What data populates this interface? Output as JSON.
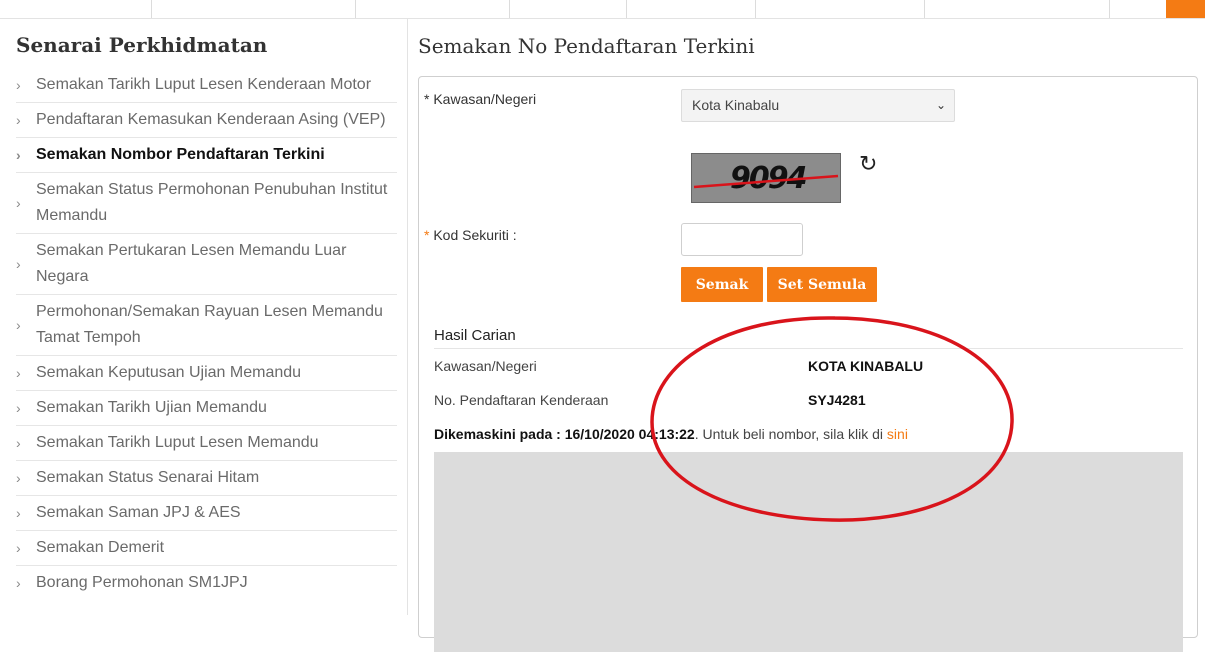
{
  "sidebar": {
    "title": "Senarai Perkhidmatan",
    "items": [
      {
        "label": "Semakan Tarikh Luput Lesen Kenderaan Motor"
      },
      {
        "label": "Pendaftaran Kemasukan Kenderaan Asing (VEP)"
      },
      {
        "label": "Semakan Nombor Pendaftaran Terkini"
      },
      {
        "label": "Semakan Status Permohonan Penubuhan Institut Memandu"
      },
      {
        "label": "Semakan Pertukaran Lesen Memandu Luar Negara"
      },
      {
        "label": "Permohonan/Semakan Rayuan Lesen Memandu Tamat Tempoh"
      },
      {
        "label": "Semakan Keputusan Ujian Memandu"
      },
      {
        "label": "Semakan Tarikh Ujian Memandu"
      },
      {
        "label": "Semakan Tarikh Luput Lesen Memandu"
      },
      {
        "label": "Semakan Status Senarai Hitam"
      },
      {
        "label": "Semakan Saman JPJ & AES"
      },
      {
        "label": "Semakan Demerit"
      },
      {
        "label": "Borang Permohonan SM1JPJ"
      }
    ]
  },
  "main": {
    "title": "Semakan No Pendaftaran Terkini",
    "form": {
      "state_label": "Kawasan/Negeri",
      "state_required_mark": "*",
      "state_value": "Kota Kinabalu",
      "captcha_text": "9094",
      "security_label": "Kod Sekuriti :",
      "security_required_mark": "*",
      "security_value": "",
      "check_button": "Semak",
      "reset_button": "Set Semula"
    },
    "result": {
      "title": "Hasil Carian",
      "rows": [
        {
          "key": "Kawasan/Negeri",
          "value": "KOTA KINABALU"
        },
        {
          "key": "No. Pendaftaran Kenderaan",
          "value": "SYJ4281"
        }
      ],
      "updated_label": "Dikemaskini pada : 16/10/2020 04:13:22",
      "updated_suffix": ". Untuk beli nombor, sila klik di ",
      "link_text": "sini"
    }
  },
  "icons": {
    "chevron": "chevron-right-icon",
    "refresh": "refresh-icon",
    "select_caret": "chevron-down-icon"
  },
  "colors": {
    "accent": "#f47b14",
    "annotation": "#d9141b"
  }
}
